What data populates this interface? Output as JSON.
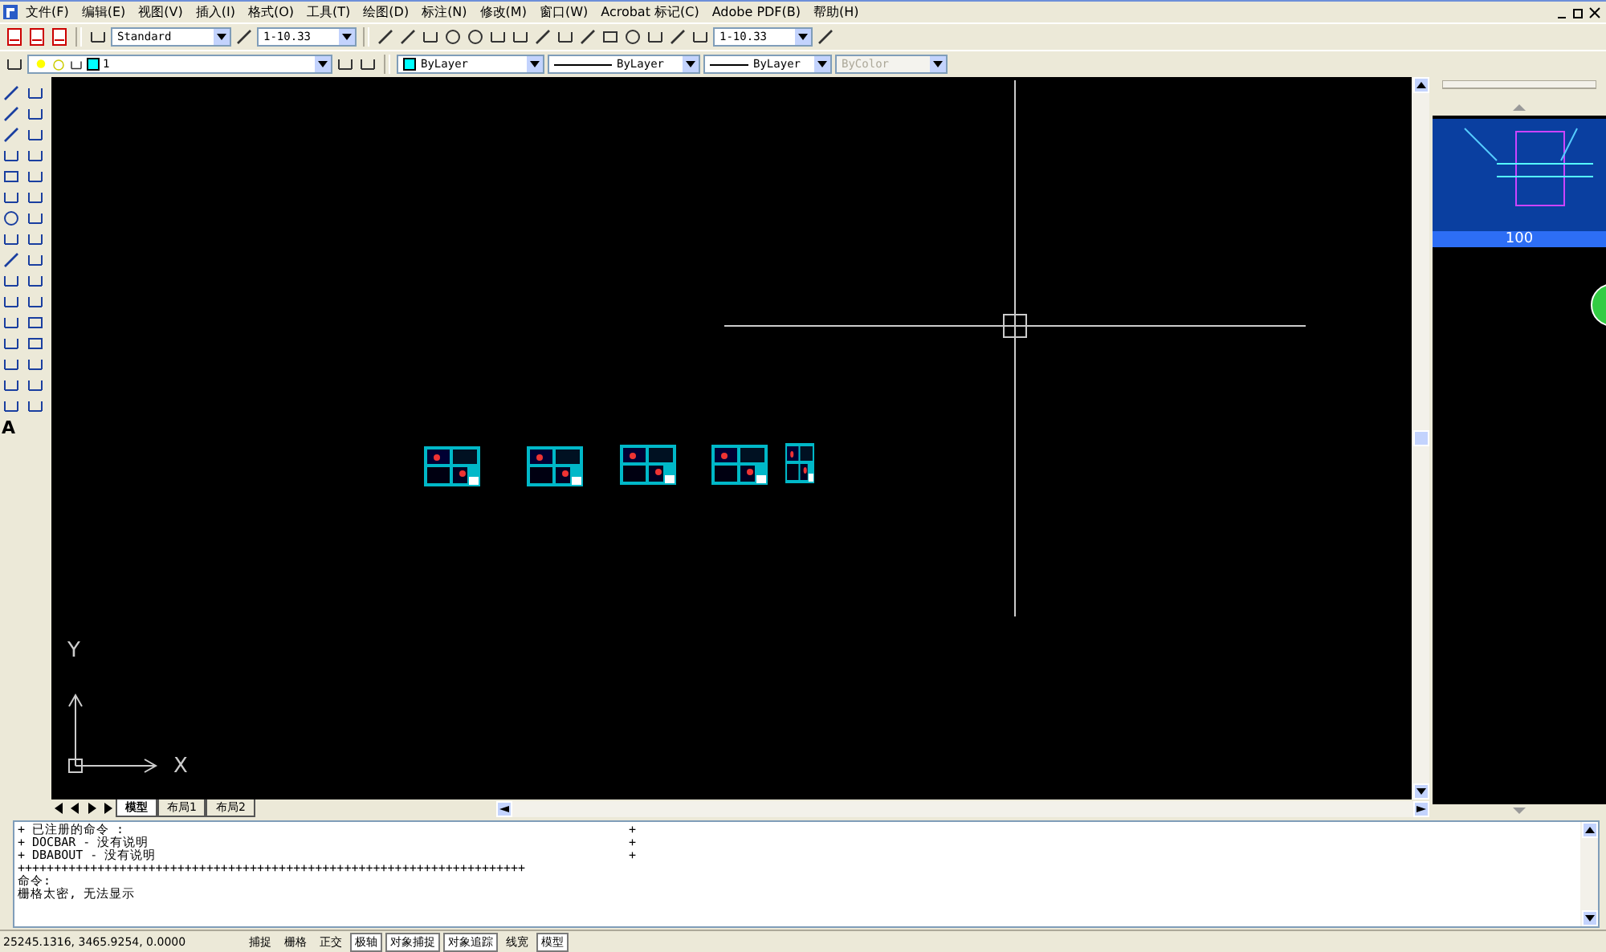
{
  "menu": [
    "文件(F)",
    "编辑(E)",
    "视图(V)",
    "插入(I)",
    "格式(O)",
    "工具(T)",
    "绘图(D)",
    "标注(N)",
    "修改(M)",
    "窗口(W)",
    "Acrobat 标记(C)",
    "Adobe PDF(B)",
    "帮助(H)"
  ],
  "toolbar": {
    "text_style": "Standard",
    "dim_style": "1-10.33",
    "dim_style_2": "1-10.33"
  },
  "tools": {
    "text_tool": "A"
  },
  "layers": {
    "layer": "1",
    "color_select": "ByLayer",
    "linetype": "ByLayer",
    "lineweight": "ByLayer",
    "plot_style": {
      "value": "ByColor",
      "disabled": true
    }
  },
  "canvas": {
    "axis_y": "Y",
    "axis_x": "X"
  },
  "layout_tabs": [
    {
      "label": "模型",
      "selected": true
    },
    {
      "label": "布局1",
      "selected": false
    },
    {
      "label": "布局2",
      "selected": false
    }
  ],
  "preview": {
    "label": "100"
  },
  "command_lines": [
    {
      "text": "+ 已注册的命令 :",
      "end": "+"
    },
    {
      "text": "+ DOCBAR - 没有说明",
      "end": "+"
    },
    {
      "text": "+ DBABOUT - 没有说明",
      "end": "+"
    },
    {
      "text": "++++++++++++++++++++++++++++++++++++++++++++++++++++++++++++++++++++++"
    },
    {
      "text": "命令:"
    },
    {
      "text": "栅格太密, 无法显示"
    }
  ],
  "status_bar": {
    "coordinates": "25245.1316, 3465.9254, 0.0000",
    "toggles": [
      {
        "label": "捕捉",
        "on": false
      },
      {
        "label": "栅格",
        "on": false
      },
      {
        "label": "正交",
        "on": false
      },
      {
        "label": "极轴",
        "on": true
      },
      {
        "label": "对象捕捉",
        "on": true
      },
      {
        "label": "对象追踪",
        "on": true
      },
      {
        "label": "线宽",
        "on": false
      },
      {
        "label": "模型",
        "on": true
      }
    ]
  }
}
